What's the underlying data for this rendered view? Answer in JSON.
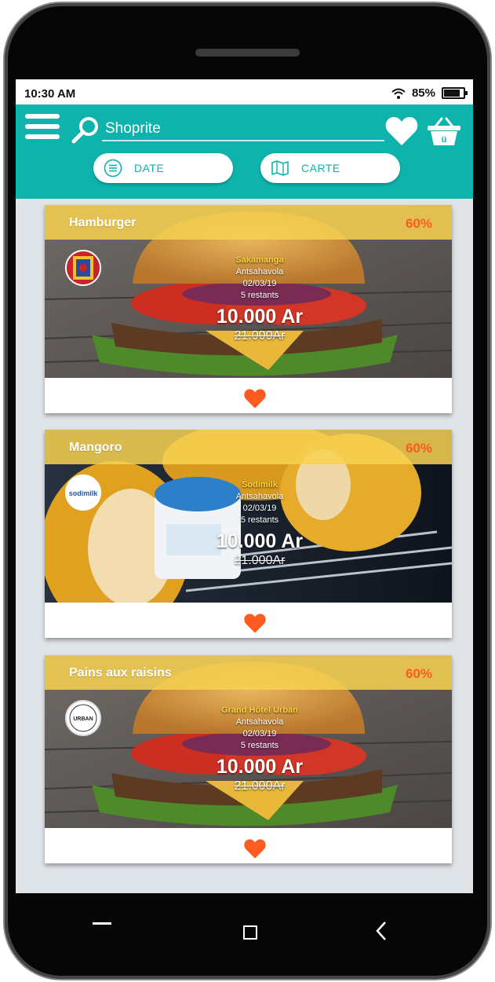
{
  "status": {
    "time": "10:30 AM",
    "battery": "85%",
    "battery_level": 0.85
  },
  "search": {
    "value": "Shoprite"
  },
  "filters": {
    "date_label": "DATE",
    "map_label": "CARTE"
  },
  "colors": {
    "accent": "#0eb3ac",
    "banner": "#f7d250",
    "discount": "#ff5a1f",
    "heart": "#ff5a1f"
  },
  "icons": {
    "menu": "menu-icon",
    "search": "search-icon",
    "favorites": "heart-icon",
    "basket": "basket-icon",
    "date": "list-icon",
    "map": "map-icon",
    "nav_recents": "recents-icon",
    "nav_home": "home-icon",
    "nav_back": "back-icon"
  },
  "cards": [
    {
      "title": "Hamburger",
      "discount": "60%",
      "shop": "Sakamanga",
      "location": "Antsahavola",
      "date": "02/03/19",
      "remaining": "5 restants",
      "price": "10.000 Ar",
      "old_price": "21.000Ar",
      "logo_text": ""
    },
    {
      "title": "Mangoro",
      "discount": "60%",
      "shop": "Sodimilk",
      "location": "Antsahavola",
      "date": "02/03/19",
      "remaining": "5 restants",
      "price": "10.000 Ar",
      "old_price": "21.000Ar",
      "logo_text": "sodimilk"
    },
    {
      "title": "Pains aux raisins",
      "discount": "60%",
      "shop": "Grand Hôtel Urban",
      "location": "Antsahavola",
      "date": "02/03/19",
      "remaining": "5 restants",
      "price": "10.000 Ar",
      "old_price": "21.000Ar",
      "logo_text": "URBAN"
    }
  ]
}
